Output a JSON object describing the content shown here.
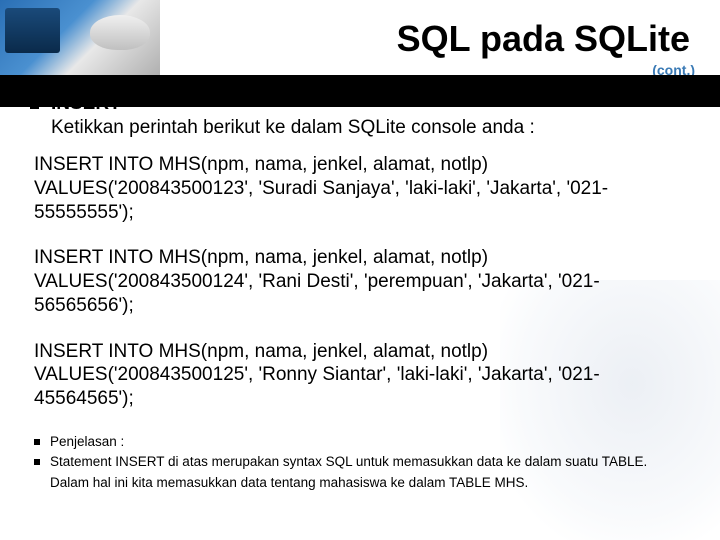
{
  "title": "SQL pada SQLite",
  "cont": "(cont.)",
  "insert": {
    "heading": "INSERT",
    "sub": "Ketikkan perintah berikut ke dalam SQLite console anda :"
  },
  "sql": {
    "stmt1_l1": "INSERT INTO MHS(npm, nama, jenkel, alamat, notlp)",
    "stmt1_l2": "VALUES('200843500123', 'Suradi Sanjaya', 'laki-laki', 'Jakarta', '021-",
    "stmt1_l3": "55555555');",
    "stmt2_l1": "INSERT INTO MHS(npm, nama, jenkel, alamat, notlp)",
    "stmt2_l2": "VALUES('200843500124', 'Rani Desti', 'perempuan', 'Jakarta', '021-",
    "stmt2_l3": "56565656');",
    "stmt3_l1": "INSERT INTO MHS(npm, nama, jenkel, alamat, notlp)",
    "stmt3_l2": "VALUES('200843500125', 'Ronny Siantar', 'laki-laki', 'Jakarta', '021-",
    "stmt3_l3": "45564565');"
  },
  "explain": {
    "label": "Penjelasan :",
    "line1": "Statement INSERT di atas merupakan syntax SQL untuk memasukkan data ke dalam suatu TABLE.",
    "line2": "Dalam hal ini kita memasukkan data tentang mahasiswa ke dalam TABLE MHS."
  }
}
